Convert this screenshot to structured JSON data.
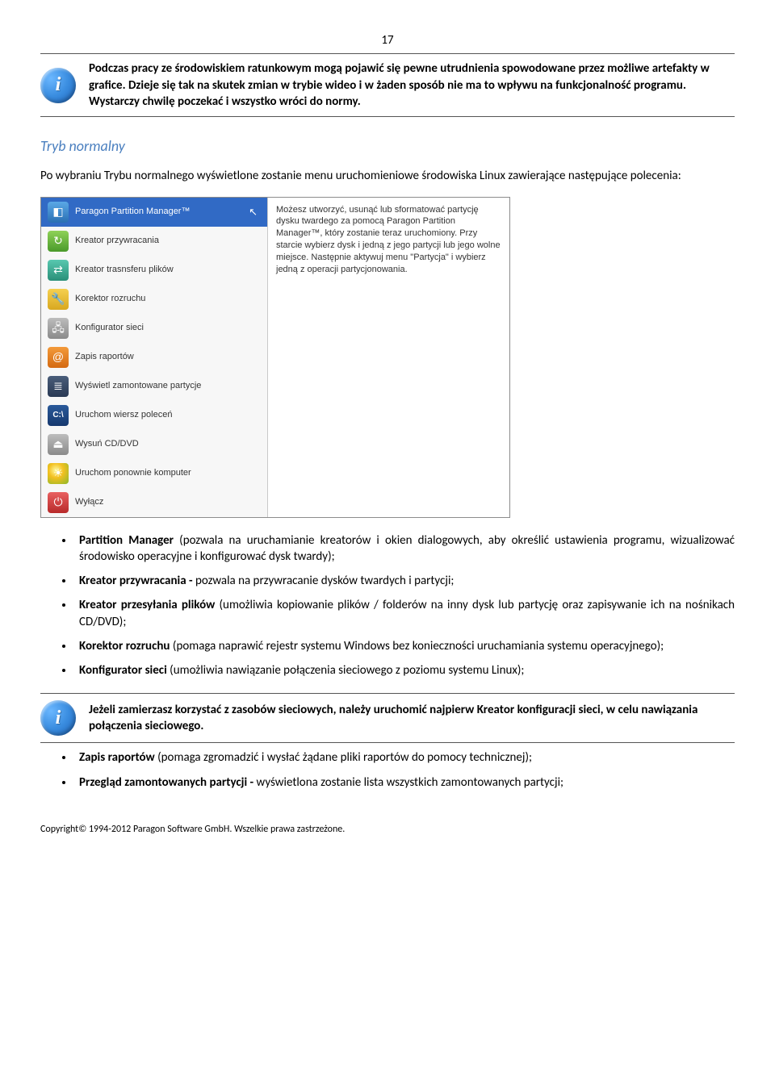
{
  "page_number": "17",
  "info_box_1": "Podczas pracy ze środowiskiem ratunkowym mogą pojawić się pewne utrudnienia spowodowane przez możliwe artefakty w grafice. Dzieje się tak na skutek zmian w trybie wideo i w żaden sposób nie ma to wpływu na funkcjonalność programu. Wystarczy chwilę poczekać i wszystko wróci do normy.",
  "section_title": "Tryb normalny",
  "intro_text": "Po wybraniu Trybu normalnego wyświetlone zostanie menu uruchomieniowe środowiska Linux zawierające następujące polecenia:",
  "menu": {
    "items": [
      "Paragon Partition Manager™",
      "Kreator przywracania",
      "Kreator trasnsferu plików",
      "Korektor rozruchu",
      "Konfigurator sieci",
      "Zapis raportów",
      "Wyświetl zamontowane partycje",
      "Uruchom wiersz poleceń",
      "Wysuń CD/DVD",
      "Uruchom ponownie komputer",
      "Wyłącz"
    ],
    "description": "Możesz utworzyć, usunąć lub sformatować partycję dysku twardego za pomocą Paragon Partition Manager™, który zostanie teraz uruchomiony. Przy starcie wybierz dysk i jedną z jego partycji lub jego wolne miejsce. Następnie aktywuj menu \"Partycja\" i wybierz jedną z operacji partycjonowania.",
    "icon_cx_label": "C:\\"
  },
  "bullets_1": [
    {
      "b": "Partition Manager",
      "t": " (pozwala na uruchamianie kreatorów i okien dialogowych, aby określić ustawienia programu, wizualizować środowisko operacyjne i konfigurować dysk twardy);"
    },
    {
      "b": "Kreator przywracania -",
      "t": " pozwala na przywracanie dysków twardych i partycji;"
    },
    {
      "b": "Kreator przesyłania plików",
      "t": " (umożliwia kopiowanie plików / folderów na inny dysk lub partycję oraz zapisywanie ich na nośnikach CD/DVD);"
    },
    {
      "b": "Korektor rozruchu",
      "t": " (pomaga naprawić rejestr systemu Windows bez konieczności uruchamiania systemu operacyjnego);"
    },
    {
      "b": "Konfigurator sieci",
      "t": " (umożliwia nawiązanie połączenia sieciowego z poziomu systemu Linux);"
    }
  ],
  "info_box_2": "Jeżeli zamierzasz korzystać z zasobów sieciowych, należy uruchomić najpierw Kreator konfiguracji sieci, w celu nawiązania połączenia sieciowego.",
  "bullets_2": [
    {
      "b": "Zapis raportów",
      "t": " (pomaga zgromadzić i wysłać żądane pliki raportów do pomocy technicznej);"
    },
    {
      "b": "Przegląd zamontowanych partycji -",
      "t": " wyświetlona zostanie lista wszystkich zamontowanych partycji;"
    }
  ],
  "footer": "Copyright© 1994-2012 Paragon Software GmbH. Wszelkie prawa zastrzeżone."
}
